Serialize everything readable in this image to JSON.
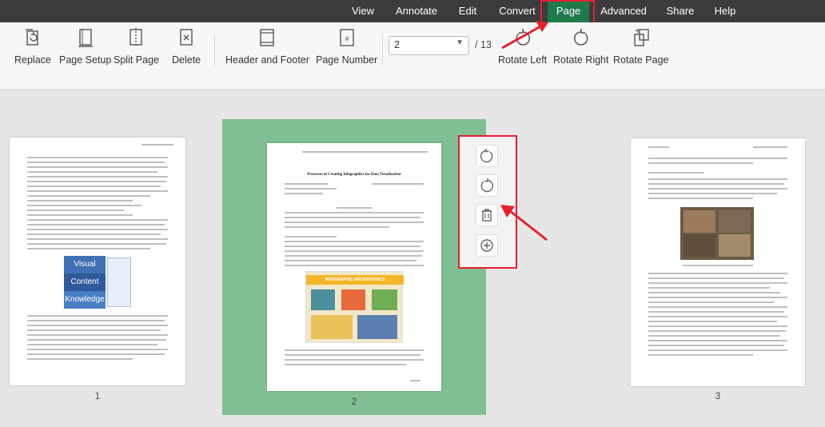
{
  "menu": {
    "items": [
      "View",
      "Annotate",
      "Edit",
      "Convert",
      "Page",
      "Advanced",
      "Share",
      "Help"
    ],
    "active": "Page"
  },
  "toolbar": {
    "replace_label": "Replace",
    "page_setup_label": "Page Setup",
    "split_page_label": "Split Page",
    "delete_label": "Delete",
    "header_footer_label": "Header and Footer",
    "page_number_label": "Page Number",
    "page_input_value": "2",
    "page_total": "/ 13",
    "rotate_left_label": "Rotate Left",
    "rotate_right_label": "Rotate Right",
    "rotate_page_label": "Rotate Page",
    "page_number_icon_glyph": "#"
  },
  "pages": [
    {
      "number": "1",
      "selected": false
    },
    {
      "number": "2",
      "selected": true,
      "title": "Processes of Creating Infographics for Data Visualization",
      "banner": "INFOGRAPHIC INFOGRAPHICS"
    },
    {
      "number": "3",
      "selected": false
    }
  ],
  "page1_diagram": [
    "Visual",
    "Content",
    "Knowledge"
  ],
  "colors": {
    "menu_bg": "#3c3c3c",
    "active_tab": "#1f7a4c",
    "selected_page_bg": "#7fbf93",
    "annotation_red": "#e8202a",
    "diagram_blue": "#3f6fb4"
  },
  "icons": [
    "replace-icon",
    "page-setup-icon",
    "split-page-icon",
    "delete-icon",
    "header-footer-icon",
    "page-number-icon",
    "rotate-left-icon",
    "rotate-right-icon",
    "rotate-page-icon",
    "rotate-clockwise-icon",
    "rotate-counterclockwise-icon",
    "trash-icon",
    "insert-page-icon"
  ]
}
